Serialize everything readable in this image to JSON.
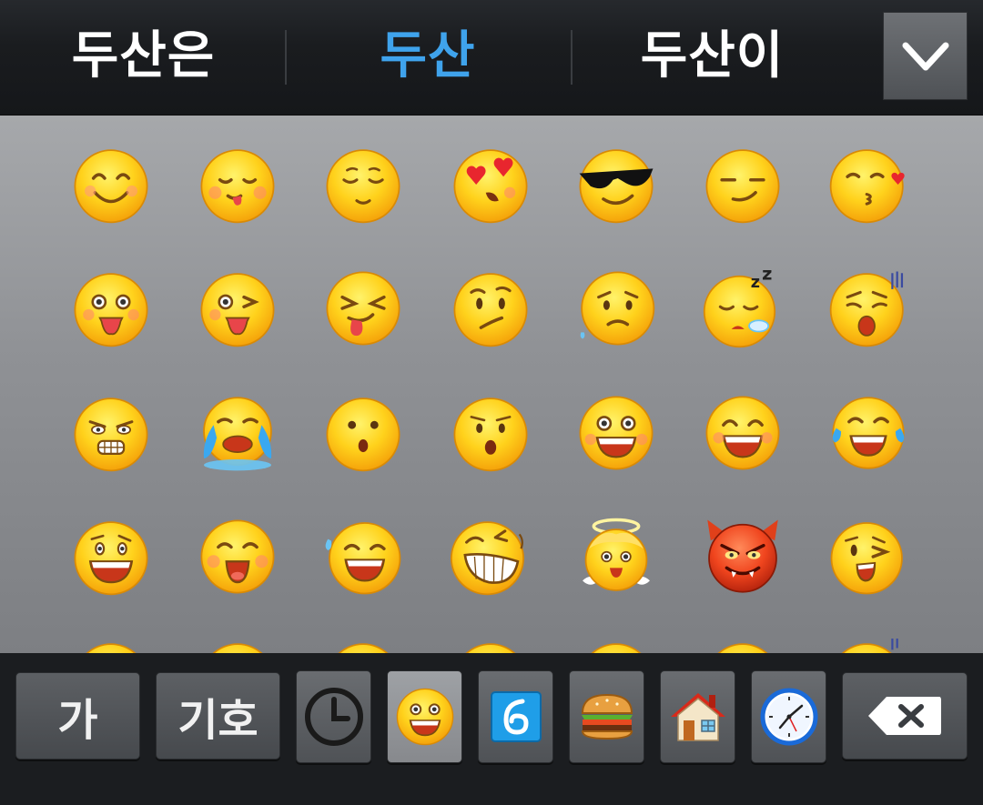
{
  "suggestion_bar": {
    "suggestions": [
      {
        "text": "두산은",
        "active": false
      },
      {
        "text": "두산",
        "active": true
      },
      {
        "text": "두산이",
        "active": false
      }
    ],
    "collapse_icon": "chevron-down-icon",
    "active_color": "#3fa3ec"
  },
  "emoji_grid": {
    "rows": [
      [
        "smiling-face-icon",
        "face-savoring-food-icon",
        "relieved-face-icon",
        "heart-eyes-face-icon",
        "sunglasses-face-icon",
        "smirking-face-icon",
        "face-blowing-kiss-icon"
      ],
      [
        "tongue-out-face-icon",
        "winking-tongue-face-icon",
        "squinting-tongue-face-icon",
        "confused-face-icon",
        "worried-face-icon",
        "sleeping-face-icon",
        "weary-face-icon"
      ],
      [
        "grimacing-face-icon",
        "loudly-crying-face-icon",
        "hushed-face-icon",
        "surprised-face-icon",
        "grinning-face-icon",
        "grinning-squinting-face-icon",
        "tears-of-joy-face-icon"
      ],
      [
        "grinning-big-eyes-face-icon",
        "smiling-open-mouth-face-icon",
        "sweat-smile-face-icon",
        "laughing-face-icon",
        "angel-face-icon",
        "devil-face-icon",
        "winking-face-icon"
      ]
    ],
    "partial_row_count": 7
  },
  "bottom_bar": {
    "hangul_key_label": "가",
    "symbols_key_label": "기호",
    "categories": [
      {
        "icon": "recent-clock-icon",
        "selected": false
      },
      {
        "icon": "smiley-category-icon",
        "selected": true
      },
      {
        "icon": "nature-swirl-category-icon",
        "selected": false
      },
      {
        "icon": "food-burger-category-icon",
        "selected": false
      },
      {
        "icon": "places-house-category-icon",
        "selected": false
      },
      {
        "icon": "objects-clock-category-icon",
        "selected": false
      }
    ],
    "backspace_icon": "backspace-icon"
  }
}
